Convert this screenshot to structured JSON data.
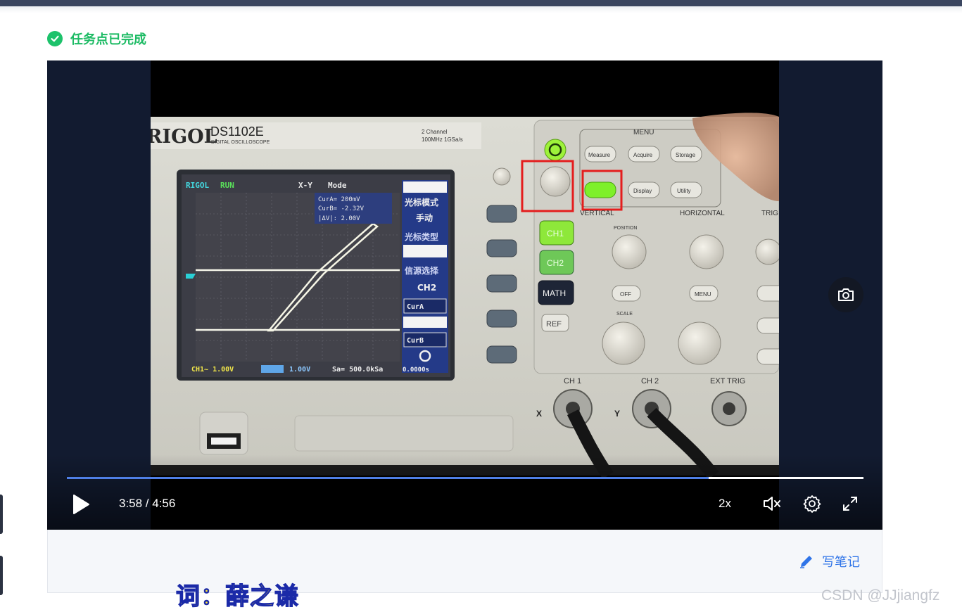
{
  "task_status": {
    "label": "任务点已完成",
    "icon": "check-circle-icon",
    "color": "#1dc26b"
  },
  "video": {
    "current_time": "3:58",
    "duration": "4:56",
    "time_display": "3:58 / 4:56",
    "progress": 0.806,
    "speed": "2x",
    "muted": true,
    "accent_color": "#4f7fe6",
    "frame": {
      "brand": "RIGOL",
      "model": "DS1102E",
      "model_sub": "DIGITAL OSCILLOSCOPE",
      "spec_line1": "2 Channel",
      "spec_line2": "100MHz 1GSa/s",
      "screen": {
        "top_left": "RIGOL",
        "run": "RUN",
        "mode_label": "X-Y",
        "mode_word": "Mode",
        "cursor_a": "CurA= 200mV",
        "cursor_b": "CurB= -2.32V",
        "delta": "|ΔV|: 2.00V",
        "menu_title": "光标模式",
        "menu_mode": "手动",
        "menu_type": "光标类型",
        "menu_source": "信源选择",
        "menu_ch": "CH2",
        "cur_a_btn": "CurA",
        "cur_b_btn": "CurB",
        "bottom_ch1": "CH1~  1.00V",
        "bottom_ch2": "1.00V",
        "bottom_sa": "Sa= 500.0kSa",
        "bottom_t": "0.0000s"
      },
      "panel": {
        "menu": "MENU",
        "measure": "Measure",
        "acquire": "Acquire",
        "storage": "Storage",
        "display": "Display",
        "utility": "Utility",
        "vertical": "VERTICAL",
        "horizontal": "HORIZONTAL",
        "trig": "TRIG",
        "position": "POSITION",
        "scale": "SCALE",
        "ch1": "CH1",
        "ch2": "CH2",
        "math": "MATH",
        "ref": "REF",
        "off": "OFF",
        "menu_btn": "MENU",
        "in_ch1": "CH 1",
        "in_ch2": "CH 2",
        "ext_trig": "EXT TRIG",
        "x": "X",
        "y": "Y"
      }
    }
  },
  "controls": {
    "play_icon": "play-icon",
    "mute_icon": "volume-mute-icon",
    "settings_icon": "gear-icon",
    "fullscreen_icon": "fullscreen-icon",
    "snapshot_icon": "camera-icon"
  },
  "note": {
    "label": "写笔记",
    "icon": "pencil-icon",
    "color": "#2f74e8"
  },
  "subtitle": {
    "key": "词：",
    "name": "薛之谦"
  },
  "watermark": "CSDN @JJjiangfz"
}
